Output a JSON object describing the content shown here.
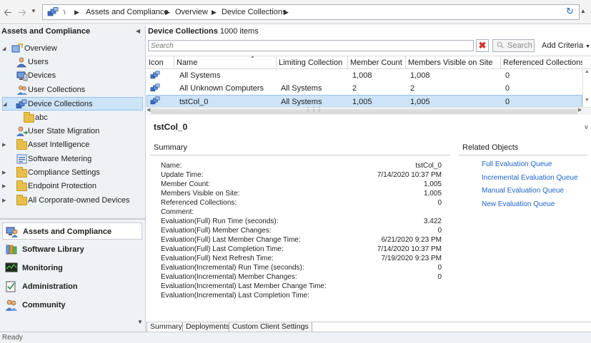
{
  "breadcrumb": {
    "root_sep": "\\",
    "items": [
      "Assets and Compliance",
      "Overview",
      "Device Collections"
    ]
  },
  "navigation": {
    "title": "Assets and Compliance",
    "tree": [
      {
        "label": "Overview"
      },
      {
        "label": "Users"
      },
      {
        "label": "Devices"
      },
      {
        "label": "User Collections"
      },
      {
        "label": "Device Collections"
      },
      {
        "label": "abc"
      },
      {
        "label": "User State Migration"
      },
      {
        "label": "Asset Intelligence"
      },
      {
        "label": "Software Metering"
      },
      {
        "label": "Compliance Settings"
      },
      {
        "label": "Endpoint Protection"
      },
      {
        "label": "All Corporate-owned Devices"
      }
    ],
    "workspaces": [
      {
        "label": "Assets and Compliance"
      },
      {
        "label": "Software Library"
      },
      {
        "label": "Monitoring"
      },
      {
        "label": "Administration"
      },
      {
        "label": "Community"
      }
    ]
  },
  "list": {
    "title": "Device Collections",
    "count": "1000 items",
    "search_placeholder": "Search",
    "search_button": "Search",
    "add_criteria": "Add Criteria",
    "columns": [
      "Icon",
      "Name",
      "Limiting Collection",
      "Member Count",
      "Members Visible on Site",
      "Referenced Collections"
    ],
    "rows": [
      {
        "name": "All Systems",
        "limiting": "",
        "member_count": "1,008",
        "visible": "1,008",
        "referenced": "0"
      },
      {
        "name": "All Unknown Computers",
        "limiting": "All Systems",
        "member_count": "2",
        "visible": "2",
        "referenced": "0"
      },
      {
        "name": "tstCol_0",
        "limiting": "All Systems",
        "member_count": "1,005",
        "visible": "1,005",
        "referenced": "0"
      }
    ]
  },
  "details": {
    "title": "tstCol_0",
    "summary_title": "Summary",
    "summary": [
      {
        "label": "Name:",
        "value": "tstCol_0"
      },
      {
        "label": "Update Time:",
        "value": "7/14/2020 10:37 PM"
      },
      {
        "label": "Member Count:",
        "value": "1,005"
      },
      {
        "label": "Members Visible on Site:",
        "value": "1,005"
      },
      {
        "label": "Referenced Collections:",
        "value": "0"
      },
      {
        "label": "Comment:",
        "value": ""
      },
      {
        "label": "Evaluation(Full) Run Time (seconds):",
        "value": "3.422"
      },
      {
        "label": "Evaluation(Full) Member Changes:",
        "value": "0"
      },
      {
        "label": "Evaluation(Full) Last Member Change Time:",
        "value": "6/21/2020 9:23 PM"
      },
      {
        "label": "Evaluation(Full) Last Completion Time:",
        "value": "7/14/2020 10:37 PM"
      },
      {
        "label": "Evaluation(Full) Next Refresh Time:",
        "value": "7/19/2020 9:23 PM"
      },
      {
        "label": "Evaluation(Incremental) Run Time (seconds):",
        "value": "0"
      },
      {
        "label": "Evaluation(Incremental) Member Changes:",
        "value": "0"
      },
      {
        "label": "Evaluation(Incremental) Last Member Change Time:",
        "value": ""
      },
      {
        "label": "Evaluation(Incremental) Last Completion Time:",
        "value": ""
      }
    ],
    "related_title": "Related Objects",
    "related": [
      "Full Evaluation Queue",
      "Incremental Evaluation Queue",
      "Manual Evaluation Queue",
      "New Evaluation Queue"
    ],
    "tabs": [
      "Summary",
      "Deployments",
      "Custom Client Settings"
    ]
  },
  "status": "Ready",
  "colors": {
    "selection": "#cde3f8",
    "link": "#1e64c8",
    "folder": "#e8bf4b"
  }
}
